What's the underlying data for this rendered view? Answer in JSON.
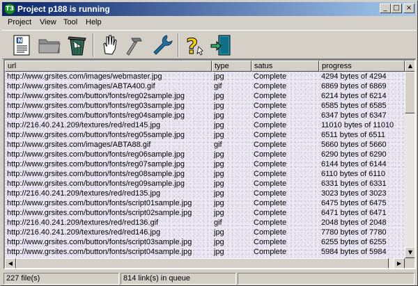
{
  "window": {
    "title": "Project p188 is running",
    "icon_glyph": "T3",
    "controls": {
      "minimize": "_",
      "maximize": "□",
      "close": "×"
    }
  },
  "menu": [
    "Project",
    "View",
    "Tool",
    "Help"
  ],
  "toolbar": [
    {
      "name": "new-document-icon"
    },
    {
      "name": "open-folder-icon"
    },
    {
      "name": "trash-icon"
    },
    {
      "name": "stop-hand-icon"
    },
    {
      "name": "hammer-icon"
    },
    {
      "name": "wrench-icon"
    },
    {
      "name": "help-icon"
    },
    {
      "name": "exit-door-icon"
    }
  ],
  "table": {
    "columns": [
      "url",
      "type",
      "satus",
      "progress"
    ],
    "rows": [
      [
        "http://www.grsites.com/images/webmaster.jpg",
        "jpg",
        "Complete",
        "4294 bytes of 4294"
      ],
      [
        "http://www.grsites.com/images/ABTA400.gif",
        "gif",
        "Complete",
        "6869 bytes of 6869"
      ],
      [
        "http://www.grsites.com/button/fonts/reg02sample.jpg",
        "jpg",
        "Complete",
        "6214 bytes of 6214"
      ],
      [
        "http://www.grsites.com/button/fonts/reg03sample.jpg",
        "jpg",
        "Complete",
        "6585 bytes of 6585"
      ],
      [
        "http://www.grsites.com/button/fonts/reg04sample.jpg",
        "jpg",
        "Complete",
        "6347 bytes of 6347"
      ],
      [
        "http://216.40.241.209/textures/red/red145.jpg",
        "jpg",
        "Complete",
        "11010 bytes of 11010"
      ],
      [
        "http://www.grsites.com/button/fonts/reg05sample.jpg",
        "jpg",
        "Complete",
        "6511 bytes of 6511"
      ],
      [
        "http://www.grsites.com/images/ABTA88.gif",
        "gif",
        "Complete",
        "5660 bytes of 5660"
      ],
      [
        "http://www.grsites.com/button/fonts/reg06sample.jpg",
        "jpg",
        "Complete",
        "6290 bytes of 6290"
      ],
      [
        "http://www.grsites.com/button/fonts/reg07sample.jpg",
        "jpg",
        "Complete",
        "6144 bytes of 6144"
      ],
      [
        "http://www.grsites.com/button/fonts/reg08sample.jpg",
        "jpg",
        "Complete",
        "6110 bytes of 6110"
      ],
      [
        "http://www.grsites.com/button/fonts/reg09sample.jpg",
        "jpg",
        "Complete",
        "6331 bytes of 6331"
      ],
      [
        "http://216.40.241.209/textures/red/red135.jpg",
        "jpg",
        "Complete",
        "3023 bytes of 3023"
      ],
      [
        "http://www.grsites.com/button/fonts/script01sample.jpg",
        "jpg",
        "Complete",
        "6475 bytes of 6475"
      ],
      [
        "http://www.grsites.com/button/fonts/script02sample.jpg",
        "jpg",
        "Complete",
        "6471 bytes of 6471"
      ],
      [
        "http://216.40.241.209/textures/red/red136.gif",
        "gif",
        "Complete",
        "2048 bytes of 2048"
      ],
      [
        "http://216.40.241.209/textures/red/red146.jpg",
        "jpg",
        "Complete",
        "7780 bytes of 7780"
      ],
      [
        "http://www.grsites.com/button/fonts/script03sample.jpg",
        "jpg",
        "Complete",
        "6255 bytes of 6255"
      ],
      [
        "http://www.grsites.com/button/fonts/script04sample.jpg",
        "jpg",
        "Complete",
        "5984 bytes of 5984"
      ]
    ]
  },
  "status": {
    "files": "227 file(s)",
    "queue": "814 link(s) in queue"
  },
  "colors": {
    "titlebar_start": "#0a246a",
    "titlebar_end": "#a6caf0",
    "window_face": "#d4d0c8",
    "list_background": "#ece8f2"
  }
}
